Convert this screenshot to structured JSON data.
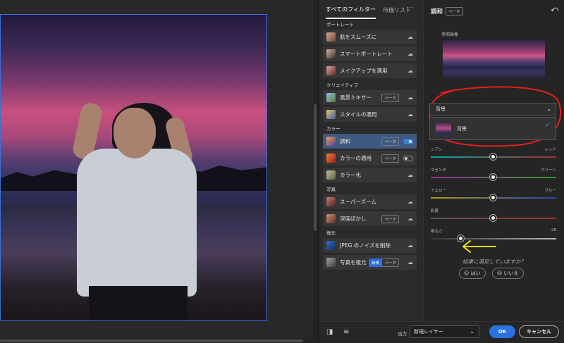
{
  "filters_panel": {
    "tabs": [
      "すべてのフィルター",
      "待機リスト"
    ],
    "more": "···",
    "categories": [
      {
        "title": "ポートレート",
        "items": [
          {
            "label": "肌をスムーズに",
            "status": "cloud"
          },
          {
            "label": "スマートポートレート",
            "status": "cloud"
          },
          {
            "label": "メイクアップを適用",
            "status": "cloud"
          }
        ]
      },
      {
        "title": "クリエイティブ",
        "items": [
          {
            "label": "風景ミキサー",
            "badge": "ベータ",
            "status": "cloud"
          },
          {
            "label": "スタイルの適用",
            "status": "cloud"
          }
        ]
      },
      {
        "title": "カラー",
        "items": [
          {
            "label": "調和",
            "badge": "ベータ",
            "status": "toggle-on",
            "selected": true
          },
          {
            "label": "カラーの適用",
            "badge": "ベータ",
            "status": "toggle-off"
          },
          {
            "label": "カラー化",
            "status": "cloud"
          }
        ]
      },
      {
        "title": "写真",
        "items": [
          {
            "label": "スーパーズーム",
            "status": "cloud"
          },
          {
            "label": "深度ぼかし",
            "badge": "ベータ",
            "status": "cloud"
          }
        ]
      },
      {
        "title": "復元",
        "items": [
          {
            "label": "JPEG のノイズを削除",
            "status": "cloud"
          },
          {
            "label": "写真を復元",
            "badge_new": "新規",
            "badge": "ベータ",
            "status": "cloud"
          }
        ]
      }
    ]
  },
  "harmony_panel": {
    "title": "調和",
    "beta": "ベータ",
    "reference_label": "参照画像",
    "dropdown_value": "背景",
    "dropdown_option": "背景",
    "sliders": [
      {
        "left": "シアン",
        "right": "レッド",
        "value": 0.5,
        "track": "cyan-red"
      },
      {
        "left": "マゼンタ",
        "right": "グリーン",
        "value": 0.5,
        "track": "magenta-green"
      },
      {
        "left": "イエロー",
        "right": "ブルー",
        "value": 0.5,
        "track": "yellow-blue"
      },
      {
        "left": "彩度",
        "right": "",
        "value": 0.5,
        "track": "saturation"
      },
      {
        "left": "明るさ",
        "right": "-28",
        "value": 0.24,
        "track": "brightness"
      }
    ],
    "feedback_question": "結果に満足していますか？",
    "yes": "はい",
    "no": "いいえ"
  },
  "footer": {
    "output_label": "出力",
    "output_value": "新規レイヤー",
    "ok": "OK",
    "cancel": "キャンセル"
  },
  "colors": {
    "accent": "#2b72e0",
    "annotation_red": "#e0201e",
    "annotation_yellow": "#f2e600"
  }
}
